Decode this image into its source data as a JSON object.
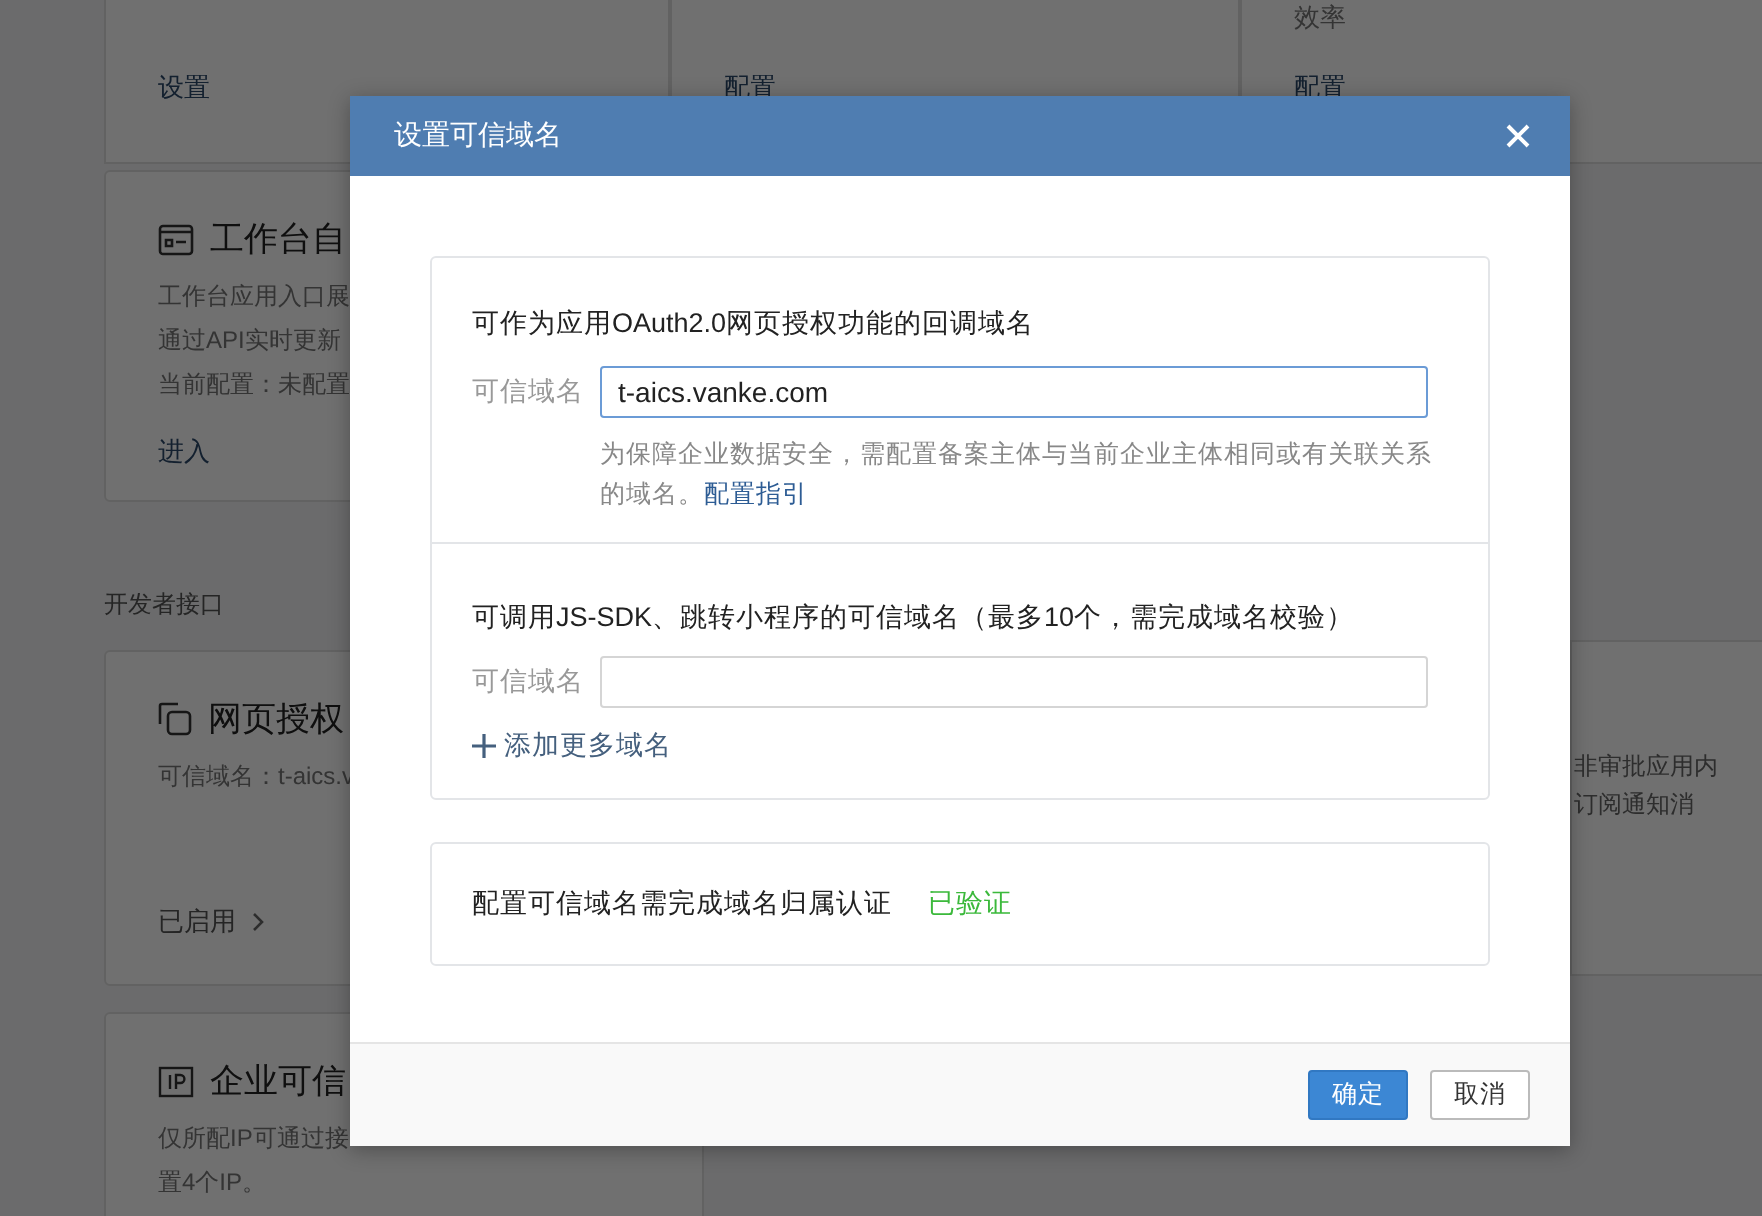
{
  "background": {
    "top_cells": [
      {
        "link": "设置"
      },
      {
        "link": "配置"
      },
      {
        "subtitle": "效率",
        "link": "配置"
      }
    ],
    "workbench_card": {
      "kind": "card",
      "title": "工作台自",
      "description": [
        "工作台应用入口展",
        "通过API实时更新"
      ],
      "config": "当前配置：未配置",
      "action": "进入"
    },
    "section_label": "开发者接口",
    "dev_cards": [
      {
        "kind": "oauth",
        "title": "网页授权",
        "description": [
          "可信域名：t-aics.v"
        ],
        "status": "已启用"
      },
      {
        "kind": "ip",
        "title": "企业可信",
        "description": [
          "仅所配IP可通过接",
          "置4个IP。"
        ]
      }
    ],
    "side_note": [
      "非审批应用内",
      "订阅通知消"
    ]
  },
  "dialog": {
    "title": "设置可信域名",
    "sections": [
      {
        "heading": "可作为应用OAuth2.0网页授权功能的回调域名",
        "field_label": "可信域名",
        "value": "t-aics.vanke.com",
        "focused": true,
        "hint": "为保障企业数据安全，需配置备案主体与当前企业主体相同或有关联关系的域名。",
        "hint_link": "配置指引"
      },
      {
        "heading": "可调用JS-SDK、跳转小程序的可信域名（最多10个，需完成域名校验）",
        "field_label": "可信域名",
        "focused": false,
        "add_link": "添加更多域名"
      }
    ],
    "verification": {
      "text": "配置可信域名需完成域名归属认证",
      "status": "已验证"
    },
    "buttons": [
      {
        "label": "确定",
        "kind": "primary"
      },
      {
        "label": "取消",
        "kind": "default"
      }
    ]
  }
}
